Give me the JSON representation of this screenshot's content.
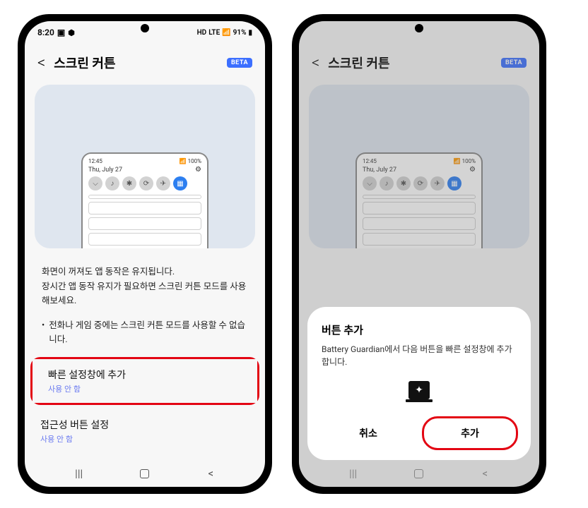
{
  "status": {
    "time": "8:20",
    "icons_net_hd": "HD",
    "icons_lte": "LTE",
    "battery_pct": "91%"
  },
  "header": {
    "title": "스크린 커튼",
    "beta": "BETA"
  },
  "preview": {
    "time": "12:45",
    "battery": "100%",
    "date": "Thu, July 27"
  },
  "desc": {
    "line": "화면이 꺼져도 앱 동작은 유지됩니다.\n장시간 앱 동작 유지가 필요하면 스크린 커튼 모드를 사용해보세요.",
    "bullet": "전화나 게임 중에는 스크린 커튼 모드를 사용할 수 없습니다."
  },
  "settings": {
    "quick_add_title": "빠른 설정창에 추가",
    "quick_add_sub": "사용 안 함",
    "a11y_title": "접근성 버튼 설정",
    "a11y_sub": "사용 안 함"
  },
  "dialog": {
    "title": "버튼 추가",
    "body": "Battery Guardian에서 다음 버튼을 빠른 설정창에 추가합니다.",
    "cancel": "취소",
    "confirm": "추가"
  }
}
